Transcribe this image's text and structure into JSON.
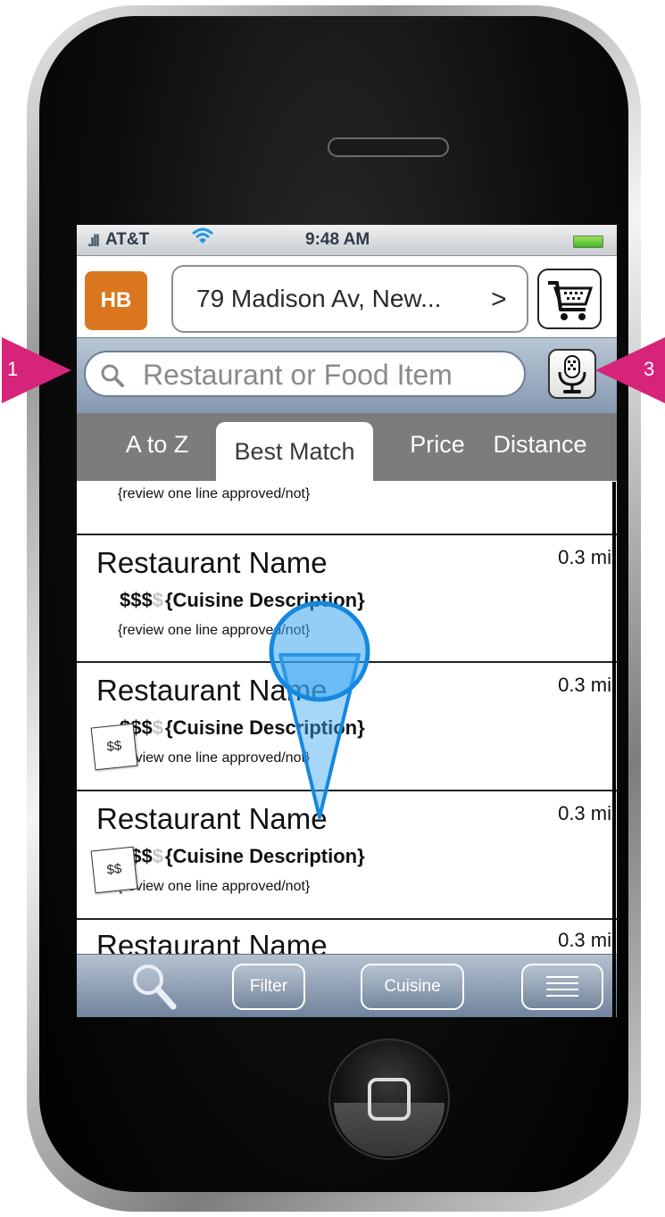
{
  "status_bar": {
    "carrier": "AT&T",
    "time": "9:48 AM"
  },
  "header": {
    "logo_text": "HB",
    "address": "79 Madison Av, New...",
    "address_chevron": ">"
  },
  "search": {
    "placeholder": "Restaurant or Food Item"
  },
  "tabs": [
    {
      "label": "A to Z",
      "active": false
    },
    {
      "label": "Best Match",
      "active": true
    },
    {
      "label": "Price",
      "active": false
    },
    {
      "label": "Distance",
      "active": false
    }
  ],
  "list": {
    "partial_top_review": "{review one line approved/not}",
    "rows": [
      {
        "name": "Restaurant Name",
        "distance": "0.3 mi",
        "price_active": "$$$",
        "price_inactive": "$",
        "cuisine": "{Cuisine Description}",
        "review": "{review one line approved/not}"
      },
      {
        "name": "Restaurant Name",
        "distance": "0.3 mi",
        "price_active": "$$$",
        "price_inactive": "$",
        "cuisine": "{Cuisine Description}",
        "review": "{review one line approved/not}",
        "tag": "$$"
      },
      {
        "name": "Restaurant Name",
        "distance": "0.3 mi",
        "price_active": "$$$",
        "price_inactive": "$",
        "cuisine": "{Cuisine Description}",
        "review": "{review one line approved/not}",
        "tag": "$$"
      },
      {
        "name": "Restaurant Name",
        "distance": "0.3 mi"
      }
    ]
  },
  "toolbar": {
    "filter": "Filter",
    "cuisine": "Cuisine"
  },
  "callouts": {
    "left": "1",
    "right": "3"
  },
  "colors": {
    "logo": "#d9761e",
    "callout": "#d6247a",
    "tap_gesture": "#3aa5f0"
  }
}
